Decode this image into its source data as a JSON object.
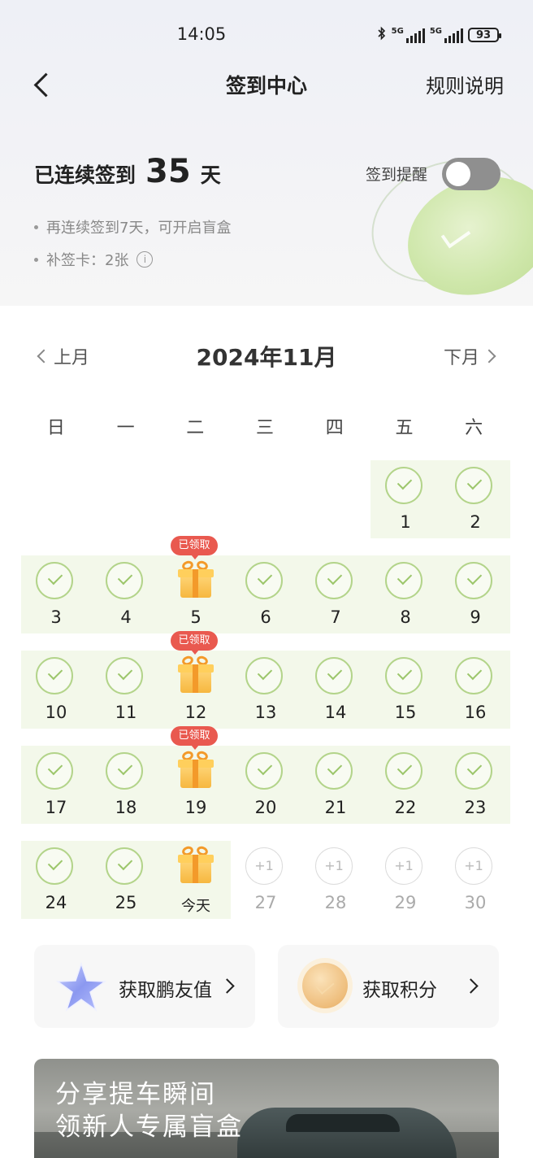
{
  "status_bar": {
    "time": "14:05",
    "signal1_label": "5G",
    "signal2_label": "5G",
    "battery": "93"
  },
  "nav": {
    "title": "签到中心",
    "rules": "规则说明"
  },
  "streak": {
    "prefix": "已连续签到",
    "days": "35",
    "unit": "天"
  },
  "reminder": {
    "label": "签到提醒",
    "enabled": false
  },
  "info": {
    "line1": "再连续签到7天，可开启盲盒",
    "line2": "补签卡：2张"
  },
  "calendar": {
    "prev": "上月",
    "title": "2024年11月",
    "next": "下月",
    "weekdays": [
      "日",
      "一",
      "二",
      "三",
      "四",
      "五",
      "六"
    ],
    "claimed_label": "已领取",
    "future_label": "+1",
    "today_label": "今天",
    "days": [
      {
        "n": "1",
        "state": "done"
      },
      {
        "n": "2",
        "state": "done"
      },
      {
        "n": "3",
        "state": "done"
      },
      {
        "n": "4",
        "state": "done"
      },
      {
        "n": "5",
        "state": "gift-claimed"
      },
      {
        "n": "6",
        "state": "done"
      },
      {
        "n": "7",
        "state": "done"
      },
      {
        "n": "8",
        "state": "done"
      },
      {
        "n": "9",
        "state": "done"
      },
      {
        "n": "10",
        "state": "done"
      },
      {
        "n": "11",
        "state": "done"
      },
      {
        "n": "12",
        "state": "gift-claimed"
      },
      {
        "n": "13",
        "state": "done"
      },
      {
        "n": "14",
        "state": "done"
      },
      {
        "n": "15",
        "state": "done"
      },
      {
        "n": "16",
        "state": "done"
      },
      {
        "n": "17",
        "state": "done"
      },
      {
        "n": "18",
        "state": "done"
      },
      {
        "n": "19",
        "state": "gift-claimed"
      },
      {
        "n": "20",
        "state": "done"
      },
      {
        "n": "21",
        "state": "done"
      },
      {
        "n": "22",
        "state": "done"
      },
      {
        "n": "23",
        "state": "done"
      },
      {
        "n": "24",
        "state": "done"
      },
      {
        "n": "25",
        "state": "done"
      },
      {
        "n": "今天",
        "state": "today-gift"
      },
      {
        "n": "27",
        "state": "future"
      },
      {
        "n": "28",
        "state": "future"
      },
      {
        "n": "29",
        "state": "future"
      },
      {
        "n": "30",
        "state": "future"
      }
    ]
  },
  "rewards": {
    "friend_value": "获取鹏友值",
    "points": "获取积分"
  },
  "banner": {
    "line1": "分享提车瞬间",
    "line2": "领新人专属盲盒"
  },
  "colors": {
    "check": "#9cc66b",
    "week_bg": "#f3f8ea",
    "badge": "#e9594f",
    "toggle_off": "#8f8f8f"
  }
}
